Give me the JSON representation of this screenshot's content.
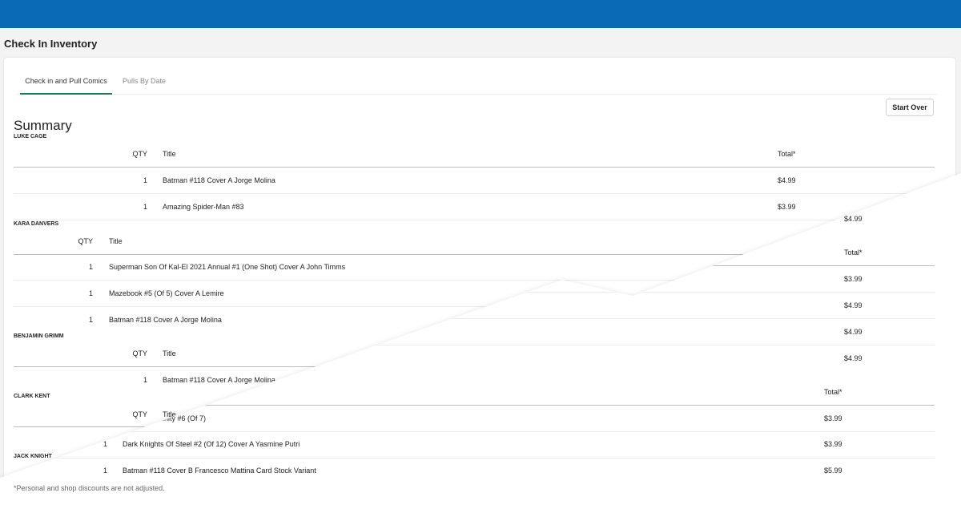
{
  "page_title": "Check In Inventory",
  "tabs": [
    {
      "label": "Check in and Pull Comics",
      "active": true
    },
    {
      "label": "Pulls By Date",
      "active": false
    }
  ],
  "start_over_label": "Start Over",
  "summary_title": "Summary",
  "headers": {
    "qty": "QTY",
    "title": "Title",
    "total": "Total*"
  },
  "customers": [
    {
      "name": "LUKE CAGE",
      "rows": [
        {
          "qty": "1",
          "title": "Batman #118 Cover A Jorge Molina",
          "total": "$4.99"
        },
        {
          "qty": "1",
          "title": "Amazing Spider-Man #83",
          "total": "$3.99"
        }
      ]
    },
    {
      "name": "KARA DANVERS",
      "rows": [
        {
          "qty": "1",
          "title": "Superman Son Of Kal-El 2021 Annual #1 (One Shot) Cover A John Timms",
          "total": "$3.99"
        },
        {
          "qty": "1",
          "title": "Mazebook #5 (Of 5) Cover A Lemire",
          "total": "$4.99"
        },
        {
          "qty": "1",
          "title": "Batman #118 Cover A Jorge Molina",
          "total": "$4.99"
        }
      ]
    },
    {
      "name": "BENJAMIN GRIMM",
      "rows": [
        {
          "qty": "1",
          "title": "Batman #118 Cover A Jorge Molina",
          "total": "$4.99"
        }
      ]
    },
    {
      "name": "CLARK KENT",
      "rows": [
        {
          "qty": "",
          "title": "Infinity #6 (Of 7)",
          "total": "$3.99"
        }
      ]
    },
    {
      "name": "JACK KNIGHT",
      "rows": [
        {
          "qty": "1",
          "title": "Dark Knights Of Steel #2 (Of 12) Cover A Yasmine Putri",
          "total": "$3.99"
        },
        {
          "qty": "1",
          "title": "Batman #118 Cover B Francesco Mattina Card Stock Variant",
          "total": "$5.99"
        }
      ]
    }
  ],
  "stray_total": "$4.99",
  "footnote": "*Personal and shop discounts are not adjusted.",
  "colors": {
    "topbar": "#0a6ab5",
    "tab_underline": "#1c7a5a"
  }
}
